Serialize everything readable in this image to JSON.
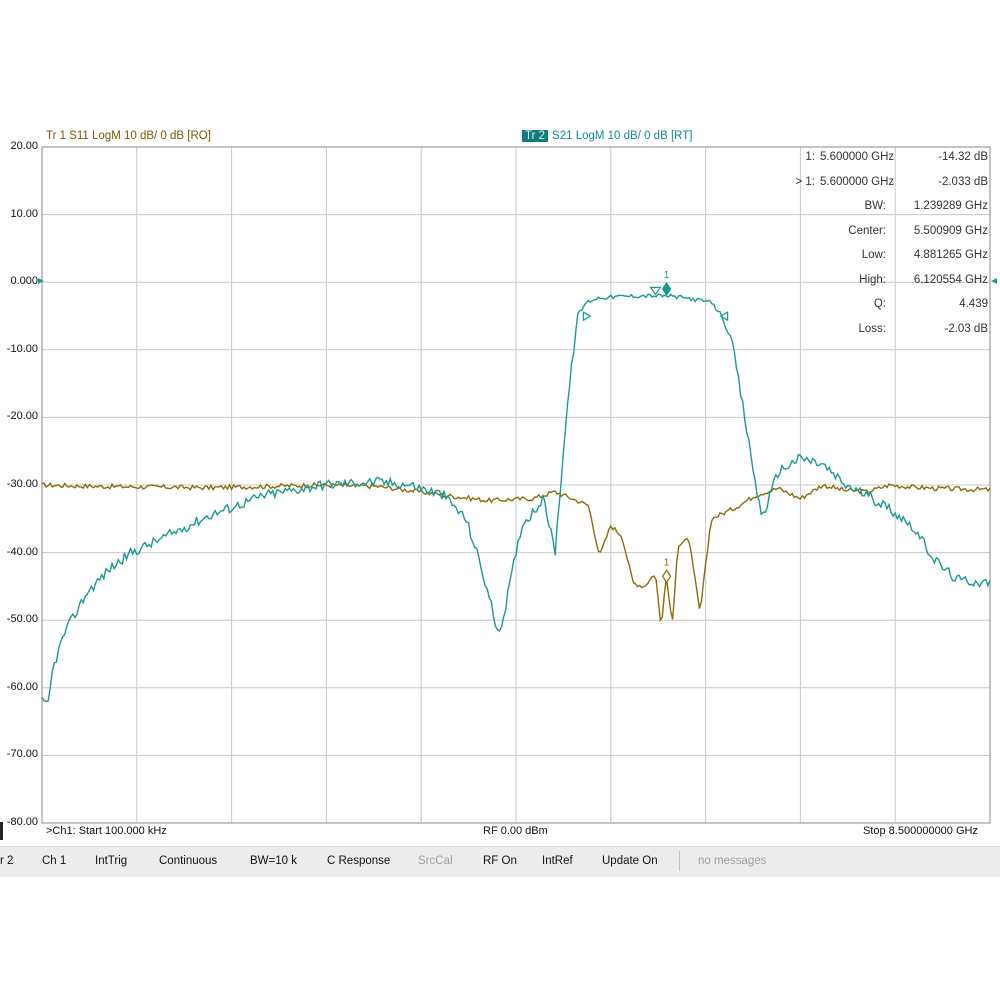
{
  "trace1_header": "Tr 1  S11 LogM 10 dB/ 0 dB [RO]",
  "trace2_tag": "Tr 2",
  "trace2_header": "S21 LogM 10 dB/ 0 dB [RT]",
  "marker_table": [
    {
      "label": "1:",
      "freq": "5.600000 GHz",
      "value": "-14.32 dB"
    },
    {
      "label": "> 1:",
      "freq": "5.600000 GHz",
      "value": "-2.033 dB"
    },
    {
      "label": "BW:",
      "value": "1.239289 GHz"
    },
    {
      "label": "Center:",
      "value": "5.500909 GHz"
    },
    {
      "label": "Low:",
      "value": "4.881265 GHz"
    },
    {
      "label": "High:",
      "value": "6.120554 GHz"
    },
    {
      "label": "Q:",
      "value": "4.439"
    },
    {
      "label": "Loss:",
      "value": "-2.03 dB"
    }
  ],
  "marker_number": "1",
  "bottom_status": {
    "start": ">Ch1: Start 100.000 kHz",
    "power": "RF 0.00 dBm",
    "stop": "Stop 8.500000000 GHz"
  },
  "softkeys": [
    {
      "label": "r 2",
      "dim": false
    },
    {
      "label": "Ch 1",
      "dim": false
    },
    {
      "label": "IntTrig",
      "dim": false
    },
    {
      "label": "Continuous",
      "dim": false
    },
    {
      "label": "BW=10 k",
      "dim": false
    },
    {
      "label": "C Response",
      "dim": false
    },
    {
      "label": "SrcCal",
      "dim": true
    },
    {
      "label": "RF On",
      "dim": false
    },
    {
      "label": "IntRef",
      "dim": false
    },
    {
      "label": "Update On",
      "dim": false
    },
    {
      "label": "no messages",
      "dim": true
    }
  ],
  "colors": {
    "s11": "#8c6d0b",
    "s21": "#1a9a92",
    "grid": "#c8c8c8",
    "frame": "#888888"
  },
  "chart_data": {
    "type": "line",
    "xlabel": "",
    "ylabel": "",
    "x_unit": "GHz",
    "xlim": [
      0.0001,
      8.5
    ],
    "ylim": [
      -80,
      20
    ],
    "y_tick_labels": [
      "20.00",
      "10.00",
      "0.000",
      "-10.00",
      "-20.00",
      "-30.00",
      "-40.00",
      "-50.00",
      "-60.00",
      "-70.00",
      "-80.00"
    ],
    "grid": true,
    "reference_level_db": 0,
    "series": [
      {
        "name": "S11",
        "x": [
          0.0001,
          0.5,
          1.0,
          1.5,
          2.0,
          2.5,
          3.0,
          3.3,
          3.6,
          4.0,
          4.4,
          4.6,
          4.9,
          5.0,
          5.1,
          5.2,
          5.3,
          5.4,
          5.5,
          5.55,
          5.6,
          5.65,
          5.7,
          5.8,
          5.9,
          6.0,
          6.2,
          6.4,
          6.6,
          6.8,
          7.0,
          7.2,
          7.4,
          7.6,
          7.8,
          8.0,
          8.2,
          8.5
        ],
        "y": [
          -30.0,
          -30.2,
          -30.3,
          -30.4,
          -30.2,
          -30.0,
          -30.2,
          -30.8,
          -31.5,
          -32.3,
          -32.0,
          -31.0,
          -33.0,
          -40.5,
          -36.0,
          -37.5,
          -44.5,
          -45.0,
          -43.0,
          -51.0,
          -43.5,
          -51.0,
          -39.0,
          -38.0,
          -49.0,
          -35.0,
          -33.5,
          -31.5,
          -30.5,
          -32.0,
          -30.0,
          -30.8,
          -31.0,
          -30.0,
          -30.3,
          -30.5,
          -30.6,
          -30.7
        ]
      },
      {
        "name": "S21",
        "x": [
          0.0001,
          0.05,
          0.1,
          0.2,
          0.4,
          0.6,
          0.8,
          1.0,
          1.5,
          2.0,
          2.5,
          3.0,
          3.3,
          3.6,
          3.8,
          3.9,
          4.0,
          4.1,
          4.3,
          4.5,
          4.55,
          4.6,
          4.7,
          4.8,
          4.88,
          4.95,
          5.0,
          5.2,
          5.4,
          5.6,
          5.8,
          6.0,
          6.1,
          6.2,
          6.4,
          6.45,
          6.5,
          6.6,
          6.8,
          7.0,
          7.2,
          7.4,
          7.6,
          7.8,
          8.0,
          8.2,
          8.5
        ],
        "y": [
          -62.0,
          -63.0,
          -57.0,
          -52.0,
          -46.0,
          -42.5,
          -40.0,
          -38.5,
          -34.5,
          -31.5,
          -30.0,
          -29.5,
          -30.0,
          -31.5,
          -35.0,
          -40.0,
          -46.0,
          -52.5,
          -36.0,
          -32.0,
          -36.0,
          -40.0,
          -20.0,
          -5.0,
          -3.0,
          -2.5,
          -2.3,
          -2.1,
          -2.0,
          -2.03,
          -2.4,
          -3.0,
          -5.0,
          -10.0,
          -30.0,
          -34.5,
          -33.0,
          -28.0,
          -26.0,
          -27.0,
          -30.0,
          -31.5,
          -33.5,
          -36.0,
          -41.0,
          -44.0,
          -44.5
        ]
      }
    ],
    "markers": [
      {
        "trace": "S11",
        "x": 5.6,
        "y": -14.32
      },
      {
        "trace": "S21",
        "x": 5.6,
        "y": -2.033
      },
      {
        "trace": "S21",
        "x": 4.881265,
        "y": -5.03
      },
      {
        "trace": "S21",
        "x": 6.120554,
        "y": -5.03
      },
      {
        "trace": "S21",
        "x": 5.500909,
        "y": -2.1
      }
    ]
  }
}
